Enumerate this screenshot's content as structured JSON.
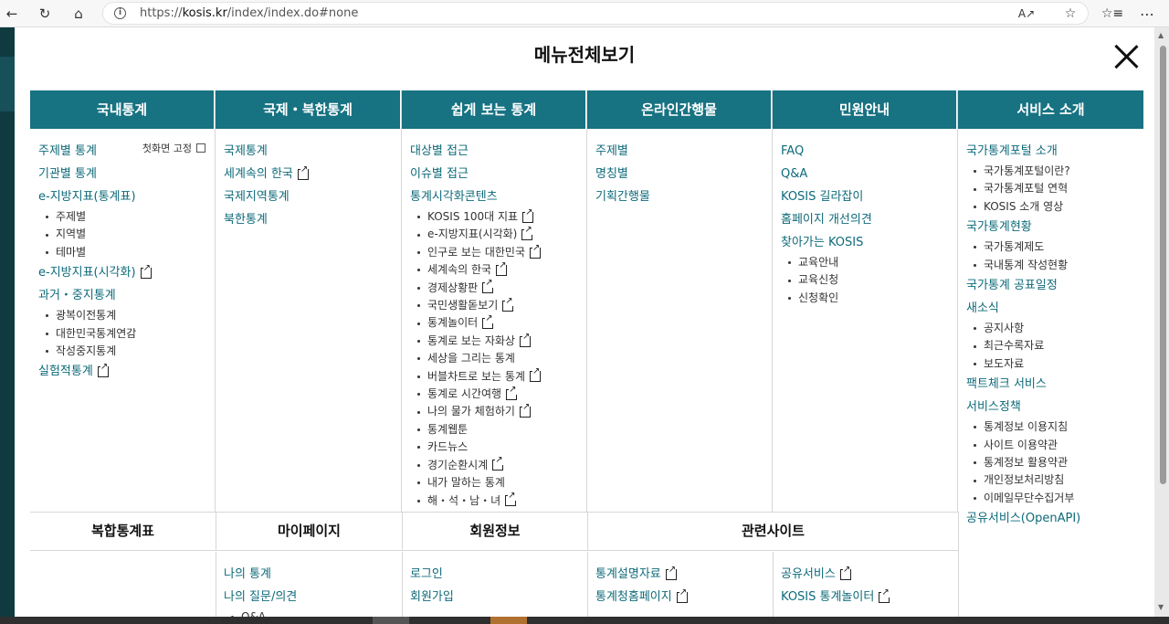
{
  "browser": {
    "url_prefix": "https://",
    "url_domain": "kosis.kr",
    "url_path": "/index/index.do#none",
    "icons": [
      "back-icon",
      "refresh-icon",
      "home-icon",
      "info-icon",
      "read-aloud-icon",
      "favorite-icon",
      "favorites-list-icon",
      "more-icon"
    ]
  },
  "modal": {
    "title": "메뉴전체보기",
    "fixed_label": "첫화면 고정"
  },
  "columns": [
    {
      "title": "국내통계",
      "items": [
        {
          "label": "주제별 통계"
        },
        {
          "label": "기관별 통계"
        },
        {
          "label": "e-지방지표(통계표)",
          "children": [
            {
              "label": "주제별"
            },
            {
              "label": "지역별"
            },
            {
              "label": "테마별"
            }
          ]
        },
        {
          "label": "e-지방지표(시각화)",
          "ext": true
        },
        {
          "label": "과거・중지통계",
          "children": [
            {
              "label": "광복이전통계"
            },
            {
              "label": "대한민국통계연감"
            },
            {
              "label": "작성중지통계"
            }
          ]
        },
        {
          "label": "실험적통계",
          "ext": true
        }
      ]
    },
    {
      "title": "국제・북한통계",
      "items": [
        {
          "label": "국제통계"
        },
        {
          "label": "세계속의 한국",
          "ext": true
        },
        {
          "label": "국제지역통계"
        },
        {
          "label": "북한통계"
        }
      ]
    },
    {
      "title": "쉽게 보는 통계",
      "items": [
        {
          "label": "대상별 접근"
        },
        {
          "label": "이슈별 접근"
        },
        {
          "label": "통계시각화콘텐츠",
          "children": [
            {
              "label": "KOSIS 100대 지표",
              "ext": true
            },
            {
              "label": "e-지방지표(시각화)",
              "ext": true
            },
            {
              "label": "인구로 보는 대한민국",
              "ext": true
            },
            {
              "label": "세계속의 한국",
              "ext": true
            },
            {
              "label": "경제상황판",
              "ext": true
            },
            {
              "label": "국민생활돋보기",
              "ext": true
            },
            {
              "label": "통계놀이터",
              "ext": true
            },
            {
              "label": "통계로 보는 자화상",
              "ext": true
            },
            {
              "label": "세상을 그리는 통계"
            },
            {
              "label": "버블차트로 보는 통계",
              "ext": true
            },
            {
              "label": "통계로 시간여행",
              "ext": true
            },
            {
              "label": "나의 물가 체험하기",
              "ext": true
            },
            {
              "label": "통계웹툰"
            },
            {
              "label": "카드뉴스"
            },
            {
              "label": "경기순환시계",
              "ext": true
            },
            {
              "label": "내가 말하는 통계"
            },
            {
              "label": "해・석・남・녀",
              "ext": true
            }
          ]
        }
      ]
    },
    {
      "title": "온라인간행물",
      "items": [
        {
          "label": "주제별"
        },
        {
          "label": "명칭별"
        },
        {
          "label": "기획간행물"
        }
      ]
    },
    {
      "title": "민원안내",
      "items": [
        {
          "label": "FAQ"
        },
        {
          "label": "Q&A"
        },
        {
          "label": "KOSIS 길라잡이"
        },
        {
          "label": "홈페이지 개선의견"
        },
        {
          "label": "찾아가는 KOSIS",
          "children": [
            {
              "label": "교육안내"
            },
            {
              "label": "교육신청"
            },
            {
              "label": "신청확인"
            }
          ]
        }
      ]
    },
    {
      "title": "서비스 소개",
      "items": [
        {
          "label": "국가통계포털 소개",
          "children": [
            {
              "label": "국가통계포털이란?"
            },
            {
              "label": "국가통계포털 연혁"
            },
            {
              "label": "KOSIS 소개 영상"
            }
          ]
        },
        {
          "label": "국가통계현황",
          "children": [
            {
              "label": "국가통계제도"
            },
            {
              "label": "국내통계 작성현황"
            }
          ]
        },
        {
          "label": "국가통계 공표일정"
        },
        {
          "label": "새소식",
          "children": [
            {
              "label": "공지사항"
            },
            {
              "label": "최근수록자료"
            },
            {
              "label": "보도자료"
            }
          ]
        },
        {
          "label": "팩트체크 서비스"
        },
        {
          "label": "서비스정책",
          "children": [
            {
              "label": "통계정보 이용지침"
            },
            {
              "label": "사이트 이용약관"
            },
            {
              "label": "통계정보 활용약관"
            },
            {
              "label": "개인정보처리방침"
            },
            {
              "label": "이메일무단수집거부"
            }
          ]
        },
        {
          "label": "공유서비스(OpenAPI)"
        }
      ]
    }
  ],
  "lower": {
    "complex": {
      "title": "복합통계표"
    },
    "mypage": {
      "title": "마이페이지",
      "items": [
        {
          "label": "나의 통계"
        },
        {
          "label": "나의 질문/의견"
        }
      ],
      "sub": [
        {
          "label": "Q&A"
        }
      ]
    },
    "member": {
      "title": "회원정보",
      "items": [
        {
          "label": "로그인"
        },
        {
          "label": "회원가입"
        }
      ]
    },
    "related": {
      "title": "관련사이트",
      "left": [
        {
          "label": "통계설명자료",
          "ext": true
        },
        {
          "label": "통계청홈페이지",
          "ext": true
        }
      ],
      "right": [
        {
          "label": "공유서비스",
          "ext": true
        },
        {
          "label": "KOSIS 통계놀이터",
          "ext": true
        }
      ]
    }
  },
  "colors": {
    "header_bg": "#177282",
    "link": "#0e6a7a"
  }
}
